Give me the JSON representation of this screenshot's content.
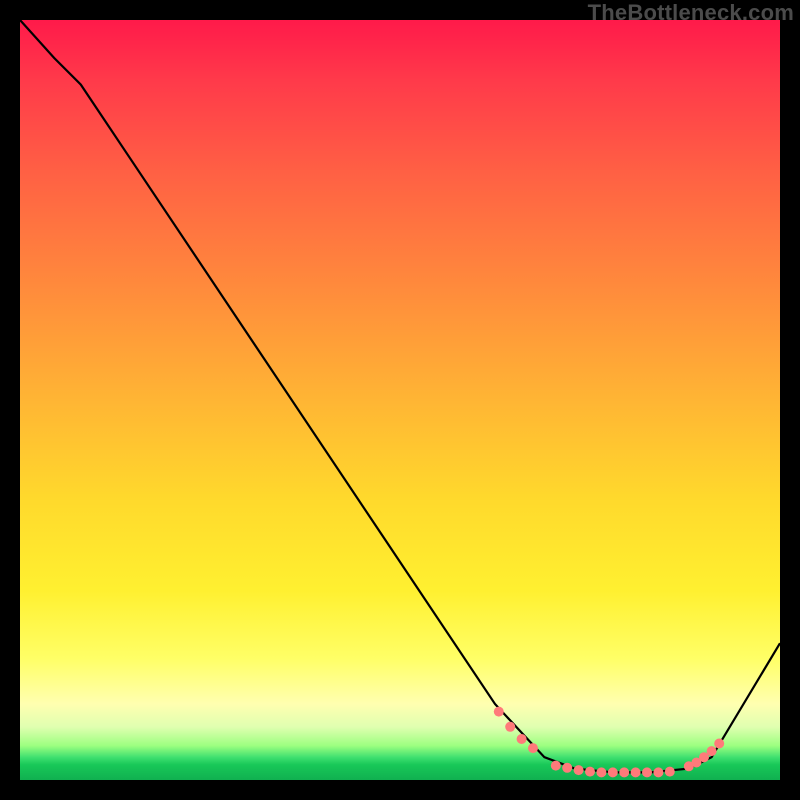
{
  "watermark": "TheBottleneck.com",
  "chart_data": {
    "type": "line",
    "title": "",
    "xlabel": "",
    "ylabel": "",
    "xlim": [
      0,
      100
    ],
    "ylim": [
      0,
      100
    ],
    "background_gradient_stops": [
      {
        "pos": 0,
        "color": "#ff1a4a"
      },
      {
        "pos": 35,
        "color": "#ff8a3c"
      },
      {
        "pos": 63,
        "color": "#ffd92c"
      },
      {
        "pos": 90,
        "color": "#ffffb0"
      },
      {
        "pos": 100,
        "color": "#10b050"
      }
    ],
    "series": [
      {
        "name": "bottleneck-curve",
        "x": [
          0.0,
          4.5,
          8.0,
          62.5,
          69.0,
          73.0,
          78.0,
          83.0,
          88.0,
          91.0,
          100.0
        ],
        "y": [
          100.0,
          95.0,
          91.5,
          10.0,
          3.0,
          1.5,
          1.0,
          1.0,
          1.5,
          3.0,
          18.0
        ]
      }
    ],
    "markers": {
      "name": "dotted-segments",
      "color": "#ff7a7a",
      "x": [
        63.0,
        64.5,
        66.0,
        67.5,
        70.5,
        72.0,
        73.5,
        75.0,
        76.5,
        78.0,
        79.5,
        81.0,
        82.5,
        84.0,
        85.5,
        88.0,
        89.0,
        90.0,
        91.0,
        92.0
      ],
      "y": [
        9.0,
        7.0,
        5.4,
        4.2,
        1.9,
        1.6,
        1.3,
        1.1,
        1.0,
        1.0,
        1.0,
        1.0,
        1.0,
        1.0,
        1.1,
        1.8,
        2.3,
        3.0,
        3.8,
        4.8
      ]
    }
  }
}
